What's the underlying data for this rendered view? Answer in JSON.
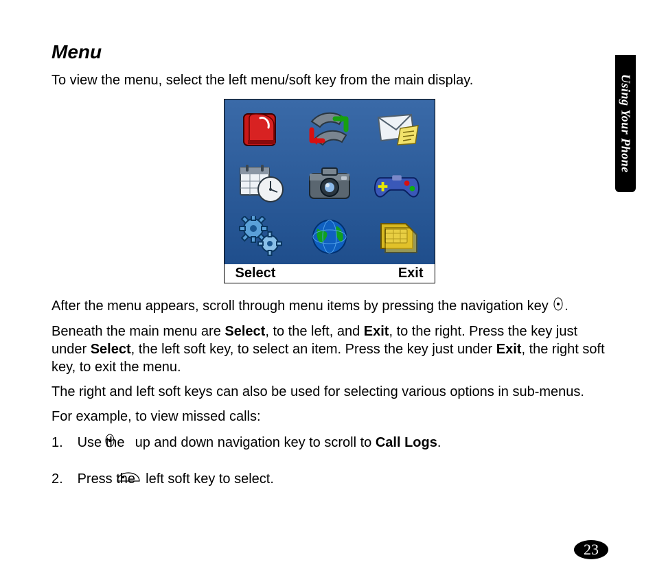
{
  "side_tab": "Using Your Phone",
  "page_number": "23",
  "heading": "Menu",
  "intro": "To view the menu, select the left menu/soft key from the main display.",
  "softkeys": {
    "left": "Select",
    "right": "Exit"
  },
  "para_after_screen": "After the menu appears, scroll through menu items by pressing the navigation key ",
  "para_after_screen_tail": ".",
  "para_select_exit_1": "Beneath the main menu are ",
  "para_select_exit_b1": "Select",
  "para_select_exit_2": ", to the left, and ",
  "para_select_exit_b2": "Exit",
  "para_select_exit_3": ", to the right. Press the key just under ",
  "para_select_exit_b3": "Select",
  "para_select_exit_4": ", the left soft key, to select an item. Press the key just under ",
  "para_select_exit_b4": "Exit",
  "para_select_exit_5": ", the right soft key, to exit the menu.",
  "para_sub": "The right and left soft keys can also be used for selecting various options in sub-menus.",
  "para_example": "For example, to view missed calls:",
  "step1_pre": "Use the ",
  "step1_post": " up and down navigation key to scroll to ",
  "step1_bold": "Call Logs",
  "step1_tail": ".",
  "step2_pre": " Press the ",
  "step2_post": " left soft key to select.",
  "step_numbers": {
    "one": "1.",
    "two": "2."
  }
}
